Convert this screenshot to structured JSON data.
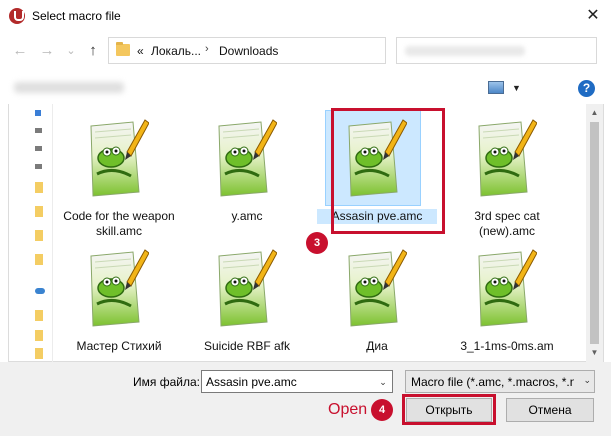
{
  "window": {
    "title": "Select macro file",
    "close_glyph": "✕"
  },
  "nav": {
    "back_glyph": "←",
    "forward_glyph": "→",
    "recent_glyph": "⌄",
    "up_glyph": "↑",
    "breadcrumb_prefix": "«",
    "breadcrumb_1": "Локаль...",
    "breadcrumb_sep": "›",
    "breadcrumb_2": "Downloads",
    "refresh_glyph": "↻"
  },
  "toolbar": {
    "view_caret": "▼",
    "help_glyph": "?"
  },
  "files": [
    {
      "name": "Code for the weapon skill.amc",
      "icon": "notepad-plus-plus-icon"
    },
    {
      "name": "y.amc",
      "icon": "notepad-plus-plus-icon"
    },
    {
      "name": "Assasin pve.amc",
      "icon": "notepad-plus-plus-icon",
      "selected": true
    },
    {
      "name": "3rd spec cat (new).amc",
      "icon": "notepad-plus-plus-icon"
    },
    {
      "name": "Мастер Стихий",
      "icon": "notepad-plus-plus-icon"
    },
    {
      "name": "Suicide RBF afk",
      "icon": "notepad-plus-plus-icon"
    },
    {
      "name": "Диа",
      "icon": "notepad-plus-plus-icon"
    },
    {
      "name": "3_1-1ms-0ms.am",
      "icon": "notepad-plus-plus-icon"
    }
  ],
  "scroll": {
    "up_glyph": "▲",
    "down_glyph": "▼"
  },
  "footer": {
    "filename_label": "Имя файла:",
    "filename_value": "Assasin pve.amc",
    "filetype_value": "Macro file (*.amc, *.macros, *.n",
    "dropdown_caret": "⌄",
    "open_label": "Открыть",
    "cancel_label": "Отмена"
  },
  "annotations": {
    "step3": "3",
    "step4": "4",
    "open_text": "Open",
    "color": "#c8102e"
  }
}
